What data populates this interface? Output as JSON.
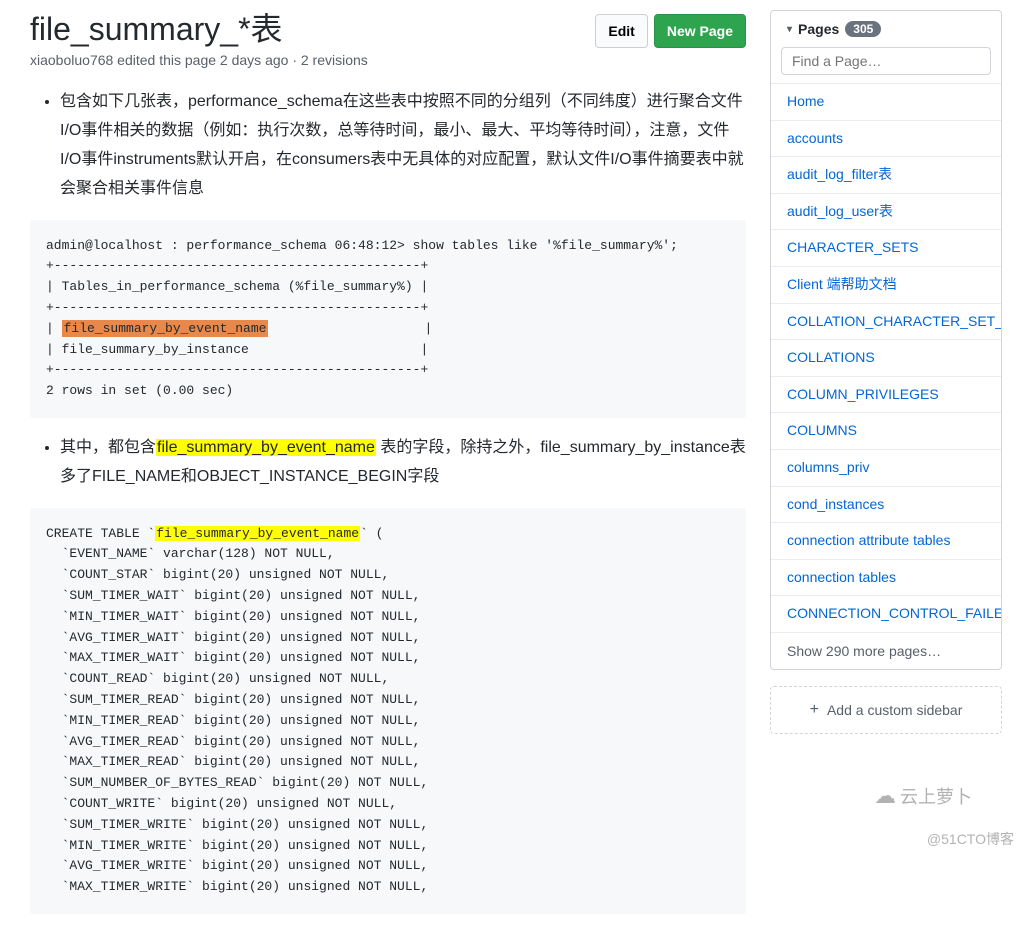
{
  "header": {
    "title": "file_summary_*表",
    "subtitle": "xiaoboluo768 edited this page 2 days ago · 2 revisions",
    "edit_label": "Edit",
    "new_page_label": "New Page"
  },
  "content": {
    "bullet1": "包含如下几张表，performance_schema在这些表中按照不同的分组列（不同纬度）进行聚合文件I/O事件相关的数据（例如：执行次数，总等待时间，最小、最大、平均等待时间），注意，文件I/O事件instruments默认开启，在consumers表中无具体的对应配置，默认文件I/O事件摘要表中就会聚合相关事件信息",
    "codeblock1": {
      "line1": "admin@localhost : performance_schema 06:48:12> show tables like '%file_summary%';",
      "line2": "+-----------------------------------------------+",
      "line3": "| Tables_in_performance_schema (%file_summary%) |",
      "line4": "+-----------------------------------------------+",
      "line5_pre": "| ",
      "line5_hl": "file_summary_by_event_name",
      "line5_post": "                    |",
      "line6": "| file_summary_by_instance                      |",
      "line7": "+-----------------------------------------------+",
      "line8": "2 rows in set (0.00 sec)"
    },
    "bullet2_pre": "其中，都包含",
    "bullet2_hl": "file_summary_by_event_name",
    "bullet2_post": " 表的字段，除持之外，file_summary_by_instance表多了FILE_NAME和OBJECT_INSTANCE_BEGIN字段",
    "codeblock2": {
      "line1_pre": "CREATE TABLE `",
      "line1_hl": "file_summary_by_event_name",
      "line1_post": "` (",
      "rest": "  `EVENT_NAME` varchar(128) NOT NULL,\n  `COUNT_STAR` bigint(20) unsigned NOT NULL,\n  `SUM_TIMER_WAIT` bigint(20) unsigned NOT NULL,\n  `MIN_TIMER_WAIT` bigint(20) unsigned NOT NULL,\n  `AVG_TIMER_WAIT` bigint(20) unsigned NOT NULL,\n  `MAX_TIMER_WAIT` bigint(20) unsigned NOT NULL,\n  `COUNT_READ` bigint(20) unsigned NOT NULL,\n  `SUM_TIMER_READ` bigint(20) unsigned NOT NULL,\n  `MIN_TIMER_READ` bigint(20) unsigned NOT NULL,\n  `AVG_TIMER_READ` bigint(20) unsigned NOT NULL,\n  `MAX_TIMER_READ` bigint(20) unsigned NOT NULL,\n  `SUM_NUMBER_OF_BYTES_READ` bigint(20) NOT NULL,\n  `COUNT_WRITE` bigint(20) unsigned NOT NULL,\n  `SUM_TIMER_WRITE` bigint(20) unsigned NOT NULL,\n  `MIN_TIMER_WRITE` bigint(20) unsigned NOT NULL,\n  `AVG_TIMER_WRITE` bigint(20) unsigned NOT NULL,\n  `MAX_TIMER_WRITE` bigint(20) unsigned NOT NULL,"
    }
  },
  "sidebar": {
    "pages_label": "Pages",
    "pages_count": "305",
    "search_placeholder": "Find a Page…",
    "items": [
      {
        "label": "Home"
      },
      {
        "label": "accounts"
      },
      {
        "label": "audit_log_filter表"
      },
      {
        "label": "audit_log_user表"
      },
      {
        "label": "CHARACTER_SETS"
      },
      {
        "label": "Client 端帮助文档"
      },
      {
        "label": "COLLATION_CHARACTER_SET_APPLICABILITY"
      },
      {
        "label": "COLLATIONS"
      },
      {
        "label": "COLUMN_PRIVILEGES"
      },
      {
        "label": "COLUMNS"
      },
      {
        "label": "columns_priv"
      },
      {
        "label": "cond_instances"
      },
      {
        "label": "connection attribute tables"
      },
      {
        "label": "connection tables"
      },
      {
        "label": "CONNECTION_CONTROL_FAILED_LOGIN_ATTEMPTS"
      }
    ],
    "more_label": "Show 290 more pages…",
    "add_sidebar_label": "Add a custom sidebar"
  },
  "watermark": {
    "cloud": "云上萝卜",
    "text": "@51CTO博客"
  }
}
